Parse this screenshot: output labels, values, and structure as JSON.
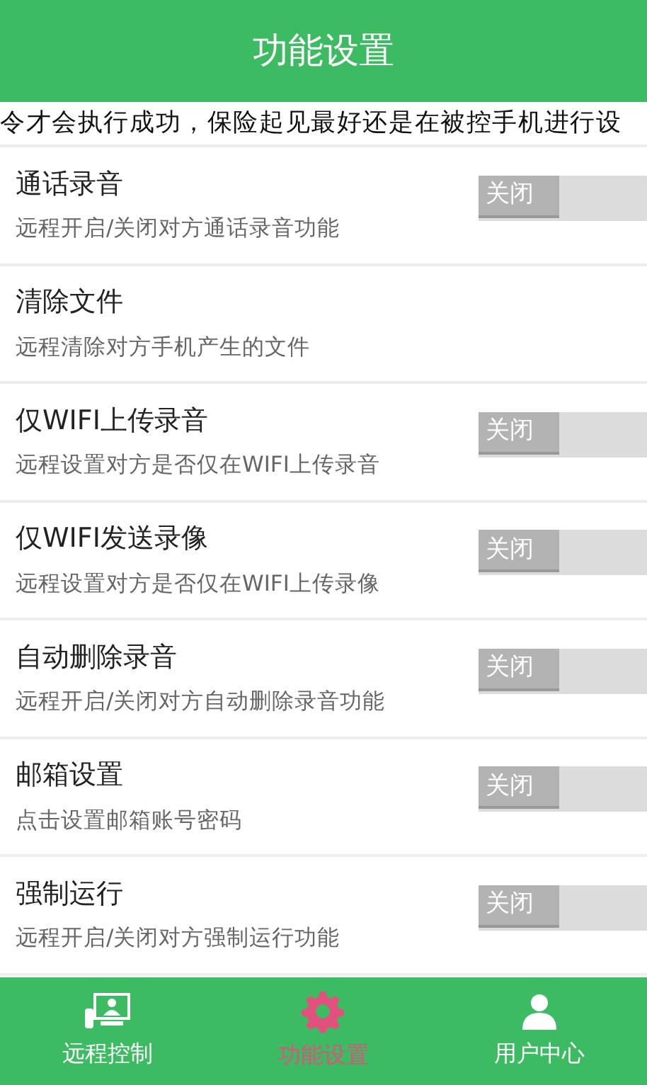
{
  "header": {
    "title": "功能设置"
  },
  "notice": "令才会执行成功，保险起见最好还是在被控手机进行设",
  "settings": [
    {
      "kind": "toggle",
      "title": "通话录音",
      "subtitle": "远程开启/关闭对方通话录音功能",
      "on": false,
      "switch_label": "关闭"
    },
    {
      "kind": "action",
      "title": "清除文件",
      "subtitle": "远程清除对方手机产生的文件"
    },
    {
      "kind": "toggle",
      "title": "仅WIFI上传录音",
      "subtitle": "远程设置对方是否仅在WIFI上传录音",
      "on": false,
      "switch_label": "关闭"
    },
    {
      "kind": "toggle",
      "title": "仅WIFI发送录像",
      "subtitle": "远程设置对方是否仅在WIFI上传录像",
      "on": false,
      "switch_label": "关闭"
    },
    {
      "kind": "toggle",
      "title": "自动删除录音",
      "subtitle": "远程开启/关闭对方自动删除录音功能",
      "on": false,
      "switch_label": "关闭"
    },
    {
      "kind": "toggle",
      "title": "邮箱设置",
      "subtitle": "点击设置邮箱账号密码",
      "on": false,
      "switch_label": "关闭"
    },
    {
      "kind": "toggle",
      "title": "强制运行",
      "subtitle": "远程开启/关闭对方强制运行功能",
      "on": false,
      "switch_label": "关闭"
    }
  ],
  "bottom_nav": [
    {
      "kind": "remote",
      "label": "远程控制",
      "selected": false
    },
    {
      "kind": "settings",
      "label": "功能设置",
      "selected": true
    },
    {
      "kind": "user",
      "label": "用户中心",
      "selected": false
    }
  ]
}
